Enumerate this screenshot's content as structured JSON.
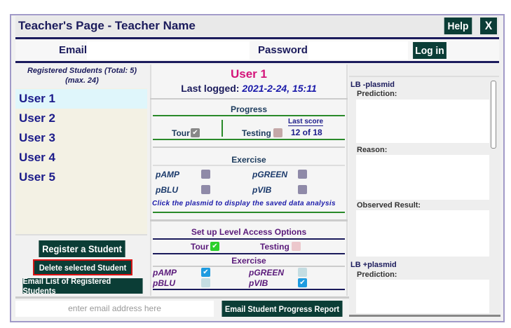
{
  "header": {
    "title": "Teacher's Page  - Teacher Name",
    "help_label": "Help",
    "close_label": "X"
  },
  "login": {
    "email_label": "Email",
    "password_label": "Password",
    "login_label": "Log in"
  },
  "students": {
    "header_line1": "Registered Students (Total: 5)",
    "header_line2": "(max. 24)",
    "items": [
      "User 1",
      "User 2",
      "User 3",
      "User 4",
      "User 5"
    ],
    "selected": "User 1"
  },
  "detail": {
    "user": "User 1",
    "last_logged_label": "Last logged:",
    "last_logged_value": "2021-2-24, 15:11",
    "progress_title": "Progress",
    "tour_label": "Tour",
    "testing_label": "Testing",
    "last_score_label": "Last score",
    "last_score_value": "12 of 18",
    "exercise_title": "Exercise",
    "plasmids": [
      "pAMP",
      "pGREEN",
      "pBLU",
      "pVIB"
    ],
    "hint": "Click the plasmid to display the saved data analysis"
  },
  "access": {
    "title": "Set up Level Access Options",
    "tour_label": "Tour",
    "tour_checked": true,
    "testing_label": "Testing",
    "testing_checked": false,
    "exercise_title": "Exercise",
    "plasmids": [
      {
        "name": "pAMP",
        "checked": true
      },
      {
        "name": "pGREEN",
        "checked": false
      },
      {
        "name": "pBLU",
        "checked": false
      },
      {
        "name": "pVIB",
        "checked": true
      }
    ]
  },
  "actions": {
    "register": "Register a Student",
    "delete": "Delete selected Student",
    "email_list": "Email List of Registered Students",
    "email_placeholder": "enter email address here",
    "email_report": "Email Student Progress Report"
  },
  "analysis": {
    "minus_title": "LB -plasmid",
    "prediction": "Prediction:",
    "reason": "Reason:",
    "observed": "Observed Result:",
    "plus_title": "LB +plasmid"
  },
  "colors": {
    "accent": "#0b3d36",
    "user_title": "#d4147a",
    "selected_row": "#dff6fb"
  }
}
